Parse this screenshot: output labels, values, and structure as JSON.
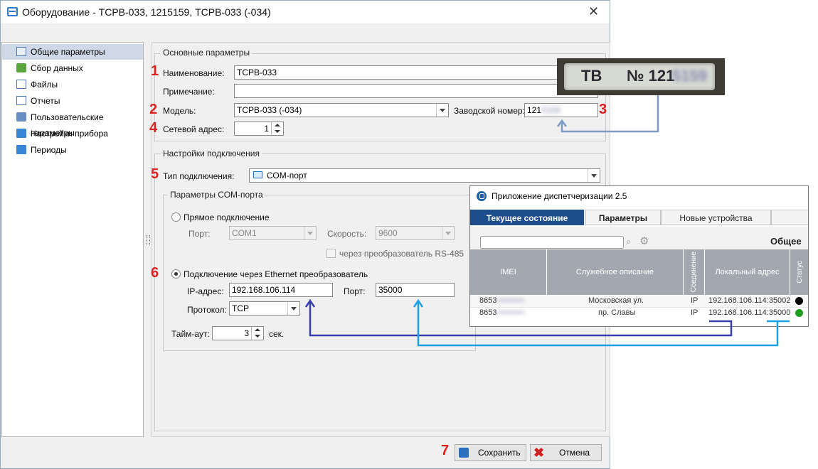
{
  "window": {
    "title": "Оборудование - ТСРВ-033, 1215159, ТСРВ-033 (-034)"
  },
  "sidebar": {
    "items": [
      {
        "label": "Общие параметры",
        "icon": "document-icon",
        "selected": true
      },
      {
        "label": "Сбор данных",
        "icon": "download-icon"
      },
      {
        "label": "Файлы",
        "icon": "file-icon"
      },
      {
        "label": "Отчеты",
        "icon": "file-icon"
      },
      {
        "label": "Пользовательские параметры",
        "icon": "users-icon"
      },
      {
        "label": "Настройки прибора",
        "icon": "folder-icon"
      },
      {
        "label": "Периоды",
        "icon": "folder-icon"
      }
    ]
  },
  "basic": {
    "title": "Основные параметры",
    "name_label": "Наименование:",
    "name_value": "ТСРВ-033",
    "note_label": "Примечание:",
    "note_value": "",
    "model_label": "Модель:",
    "model_value": "ТСРВ-033 (-034)",
    "serial_label": "Заводской номер:",
    "serial_value": "121",
    "serial_hidden": "5159",
    "address_label": "Сетевой адрес:",
    "address_value": "1"
  },
  "connection": {
    "title": "Настройки подключения",
    "type_label": "Тип подключения:",
    "type_value": "СОМ-порт",
    "com_title": "Параметры СОМ-порта",
    "direct_label": "Прямое подключение",
    "port_label": "Порт:",
    "port_value": "COM1",
    "speed_label": "Скорость:",
    "speed_value": "9600",
    "rs485_label": "через преобразователь RS-485",
    "ethernet_label": "Подключение через Ethernet преобразователь",
    "ip_label": "IP-адрес:",
    "ip_value": "192.168.106.114",
    "eport_label": "Порт:",
    "eport_value": "35000",
    "protocol_label": "Протокол:",
    "protocol_value": "TCP",
    "timeout_label": "Тайм-аут:",
    "timeout_value": "3",
    "timeout_unit": "сек."
  },
  "buttons": {
    "save": "Сохранить",
    "cancel": "Отмена"
  },
  "markers": [
    "1",
    "2",
    "3",
    "4",
    "5",
    "6",
    "7"
  ],
  "photo": {
    "plate_letters": "ТВ",
    "plate_number": "№ 121",
    "plate_hidden": "5159"
  },
  "dispatcher": {
    "title": "Приложение диспетчеризации 2.5",
    "tabs": [
      "Текущее состояние",
      "Параметры",
      "Новые устройства"
    ],
    "heading": "Общее с",
    "columns": [
      "IMEI",
      "Служебное описание",
      "Соединение",
      "Локальный адрес",
      "Статус"
    ],
    "rows": [
      {
        "imei": "8653",
        "desc": "Московская ул.",
        "conn": "IP",
        "addr": "192.168.106.114:35002",
        "status_color": "#000000"
      },
      {
        "imei": "8653",
        "desc": "пр. Славы",
        "conn": "IP",
        "addr": "192.168.106.114:35000",
        "status_color": "#1ea01e"
      }
    ]
  },
  "colors": {
    "marker": "#e02020",
    "arrow_photo": "#7e9ac7",
    "arrow_ip": "#3a3fb0",
    "arrow_port": "#1da0e0"
  }
}
